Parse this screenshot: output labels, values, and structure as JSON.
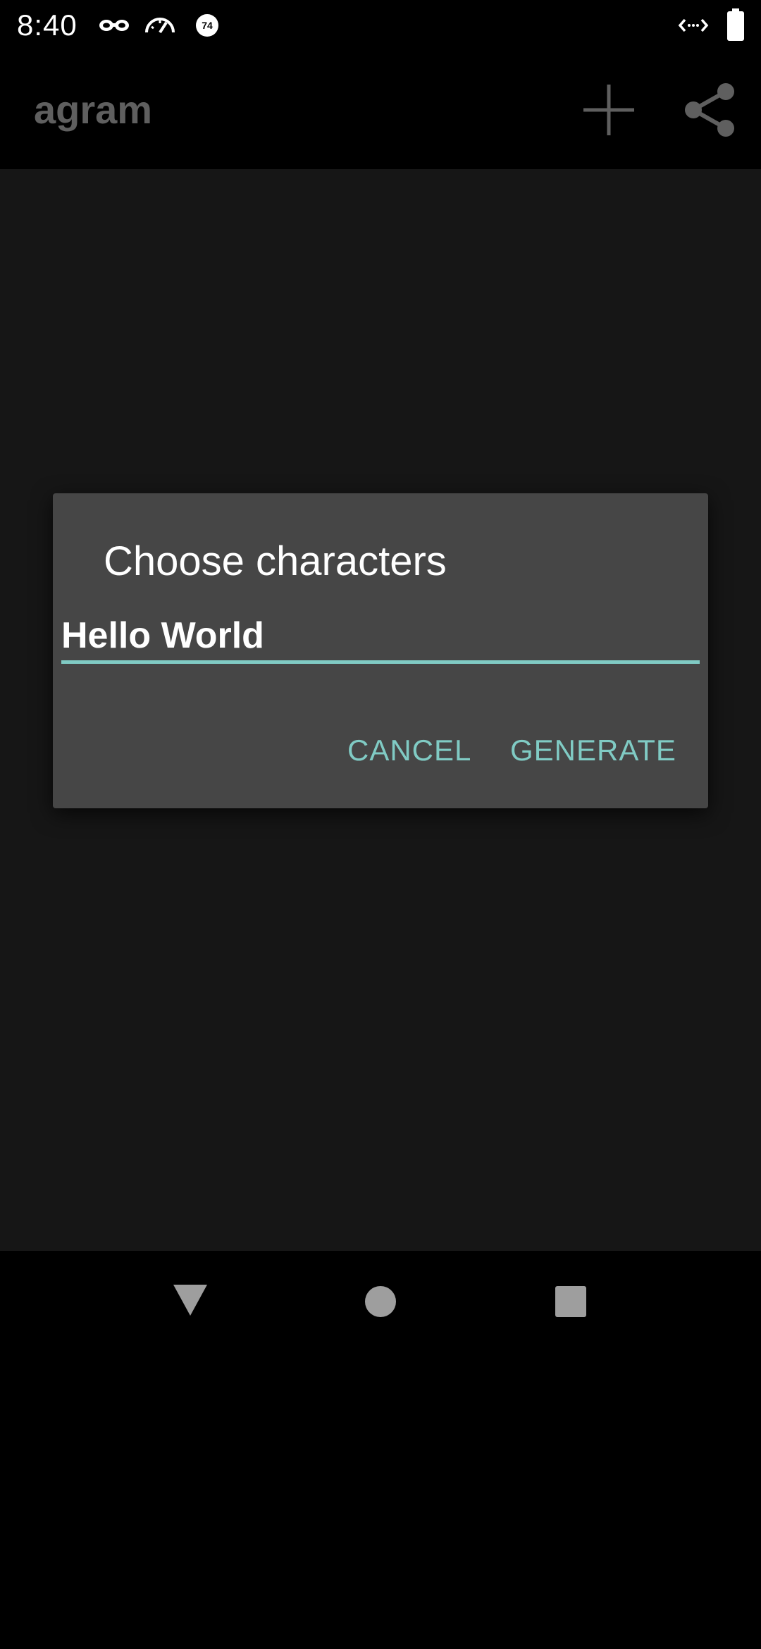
{
  "status_bar": {
    "time": "8:40",
    "icons": [
      "incognito-icon",
      "speedometer-icon",
      "badge-74-icon",
      "code-brackets-icon",
      "battery-icon"
    ],
    "badge_number": "74"
  },
  "app_bar": {
    "title": "agram",
    "actions": [
      "add-icon",
      "share-icon"
    ]
  },
  "dialog": {
    "title": "Choose characters",
    "input_value": "Hello World",
    "cancel_label": "CANCEL",
    "generate_label": "GENERATE"
  },
  "nav_bar": {
    "buttons": [
      "back-icon",
      "home-icon",
      "recents-icon"
    ]
  },
  "colors": {
    "accent": "#80cbc4",
    "dialog_bg": "#464646",
    "scrim": "#161616",
    "title_dim": "#5f5f5f"
  }
}
